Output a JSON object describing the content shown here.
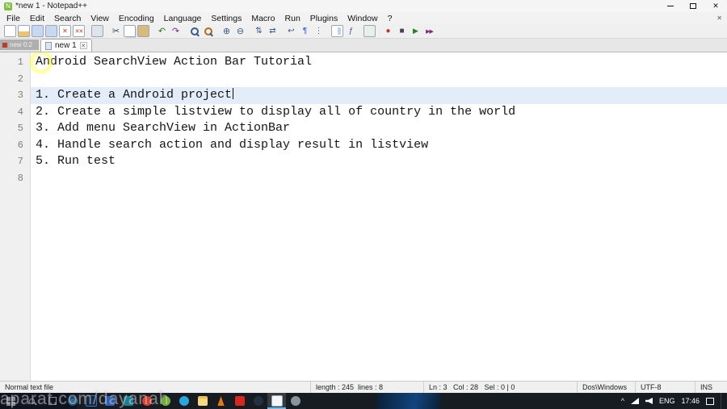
{
  "window": {
    "title": "*new 1 - Notepad++"
  },
  "icons": {
    "close": "✕",
    "tab_close": "✕",
    "chevron_up": "^"
  },
  "menu": {
    "items": [
      "File",
      "Edit",
      "Search",
      "View",
      "Encoding",
      "Language",
      "Settings",
      "Macro",
      "Run",
      "Plugins",
      "Window",
      "?"
    ]
  },
  "toolbar": {
    "icons": [
      "new-file",
      "open-file",
      "save-file",
      "save-all",
      "close-file",
      "close-all",
      "print",
      "cut",
      "copy",
      "paste",
      "undo",
      "redo",
      "find",
      "replace",
      "zoom-in",
      "zoom-out",
      "sync-vertical-scroll",
      "sync-horizontal-scroll",
      "word-wrap",
      "show-all-characters",
      "indent-guide",
      "document-map",
      "function-list",
      "monitor",
      "record-macro",
      "stop-macro",
      "playback-macro",
      "run-macro"
    ]
  },
  "tabs": [
    {
      "label": "new 1",
      "active": true
    }
  ],
  "editor": {
    "lines": [
      {
        "num": "1",
        "text": "Android SearchView Action Bar Tutorial"
      },
      {
        "num": "2",
        "text": ""
      },
      {
        "num": "3",
        "text": "1. Create a Android project",
        "current": true,
        "caret": true
      },
      {
        "num": "4",
        "text": "2. Create a simple listview to display all of country in the world"
      },
      {
        "num": "5",
        "text": "3. Add menu SearchView in ActionBar"
      },
      {
        "num": "6",
        "text": "4. Handle search action and display result in listview"
      },
      {
        "num": "7",
        "text": "5. Run test"
      },
      {
        "num": "8",
        "text": ""
      }
    ]
  },
  "statusbar": {
    "segments": [
      "Normal text file",
      "length : 245  lines : 8",
      "Ln : 3   Col : 28   Sel : 0 | 0",
      "Dos\\Windows",
      "UTF-8",
      "INS"
    ]
  },
  "taskbar": {
    "app_icons": [
      "edge",
      "photoshop",
      "word",
      "visual-studio",
      "opera",
      "android-studio",
      "telegram",
      "file-explorer",
      "vlc",
      "youtube",
      "steam",
      "notepad-plus-plus",
      "settings"
    ],
    "active_index": 11,
    "language": "ENG",
    "time": "17:46"
  },
  "overlay": {
    "watermark": "aparat.com/dayanah",
    "ghost_label": "new 0:2"
  }
}
